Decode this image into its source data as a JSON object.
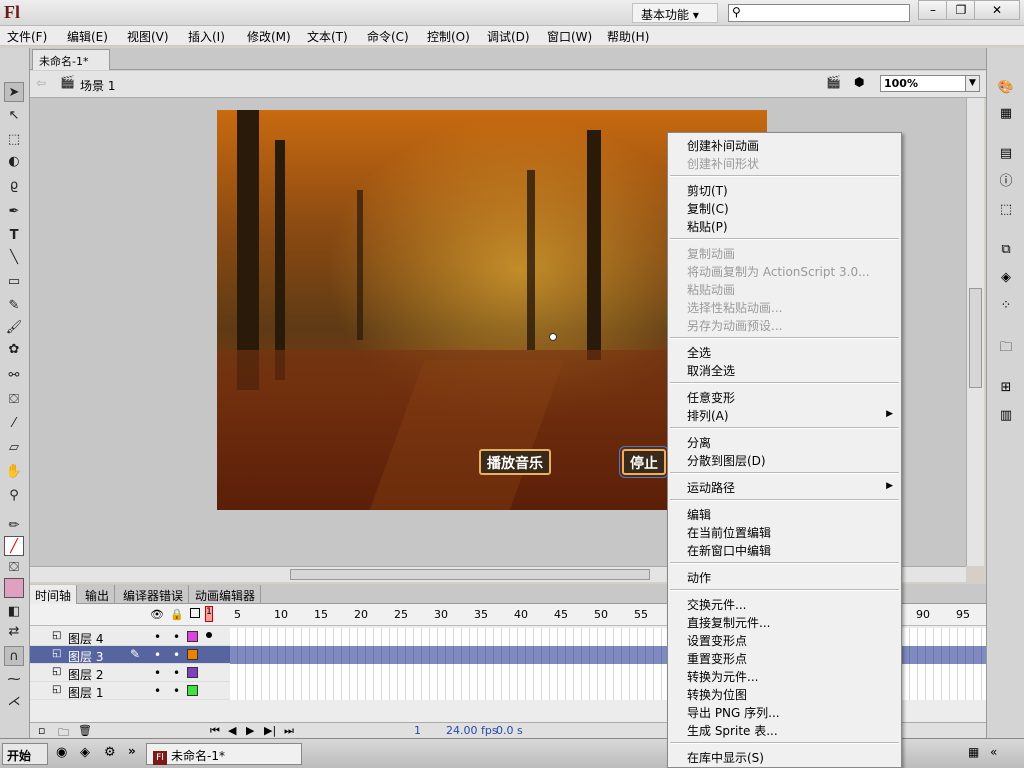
{
  "app": {
    "logo": "Fl",
    "workspace": "基本功能 ▾",
    "window_buttons": [
      "–",
      "❐",
      "✕"
    ]
  },
  "menu": [
    "文件(F)",
    "编辑(E)",
    "视图(V)",
    "插入(I)",
    "修改(M)",
    "文本(T)",
    "命令(C)",
    "控制(O)",
    "调试(D)",
    "窗口(W)",
    "帮助(H)"
  ],
  "document": {
    "tab_title": "未命名-1*",
    "tab_close": "×",
    "scene": "场景 1",
    "zoom": "100%"
  },
  "stage": {
    "play_label": "播放音乐",
    "stop_label": "停止"
  },
  "panel_tabs": [
    "时间轴",
    "输出",
    "编译器错误",
    "动画编辑器"
  ],
  "timeline": {
    "frame_numbers": [
      "5",
      "10",
      "15",
      "20",
      "25",
      "30",
      "35",
      "40",
      "45",
      "50",
      "55",
      "90",
      "95"
    ],
    "current_frame": "1",
    "fps": "24.00 fps",
    "time": "0.0 s",
    "layers": [
      {
        "name": "图层 4",
        "color": "#e040e0",
        "selected": false
      },
      {
        "name": "图层 3",
        "color": "#f08000",
        "selected": true
      },
      {
        "name": "图层 2",
        "color": "#8040c0",
        "selected": false
      },
      {
        "name": "图层 1",
        "color": "#40e040",
        "selected": false
      }
    ]
  },
  "context_menu": {
    "items": [
      {
        "label": "创建补间动画",
        "disabled": false
      },
      {
        "label": "创建补间形状",
        "disabled": true
      },
      {
        "label": "剪切(T)",
        "disabled": false
      },
      {
        "label": "复制(C)",
        "disabled": false
      },
      {
        "label": "粘贴(P)",
        "disabled": false
      },
      {
        "label": "复制动画",
        "disabled": true
      },
      {
        "label": "将动画复制为 ActionScript 3.0...",
        "disabled": true
      },
      {
        "label": "粘贴动画",
        "disabled": true
      },
      {
        "label": "选择性粘贴动画...",
        "disabled": true
      },
      {
        "label": "另存为动画预设...",
        "disabled": true
      },
      {
        "label": "全选",
        "disabled": false
      },
      {
        "label": "取消全选",
        "disabled": false
      },
      {
        "label": "任意变形",
        "disabled": false
      },
      {
        "label": "排列(A)",
        "disabled": false
      },
      {
        "label": "分离",
        "disabled": false
      },
      {
        "label": "分散到图层(D)",
        "disabled": false
      },
      {
        "label": "运动路径",
        "disabled": false
      },
      {
        "label": "编辑",
        "disabled": false
      },
      {
        "label": "在当前位置编辑",
        "disabled": false
      },
      {
        "label": "在新窗口中编辑",
        "disabled": false
      },
      {
        "label": "动作",
        "disabled": false
      },
      {
        "label": "交换元件...",
        "disabled": false
      },
      {
        "label": "直接复制元件...",
        "disabled": false
      },
      {
        "label": "设置变形点",
        "disabled": false
      },
      {
        "label": "重置变形点",
        "disabled": false
      },
      {
        "label": "转换为元件...",
        "disabled": false
      },
      {
        "label": "转换为位图",
        "disabled": false
      },
      {
        "label": "导出 PNG 序列...",
        "disabled": false
      },
      {
        "label": "生成 Sprite 表...",
        "disabled": false
      },
      {
        "label": "在库中显示(S)",
        "disabled": false
      }
    ]
  },
  "taskbar": {
    "start": "开始",
    "chevron": "»",
    "task": "未命名-1*"
  }
}
